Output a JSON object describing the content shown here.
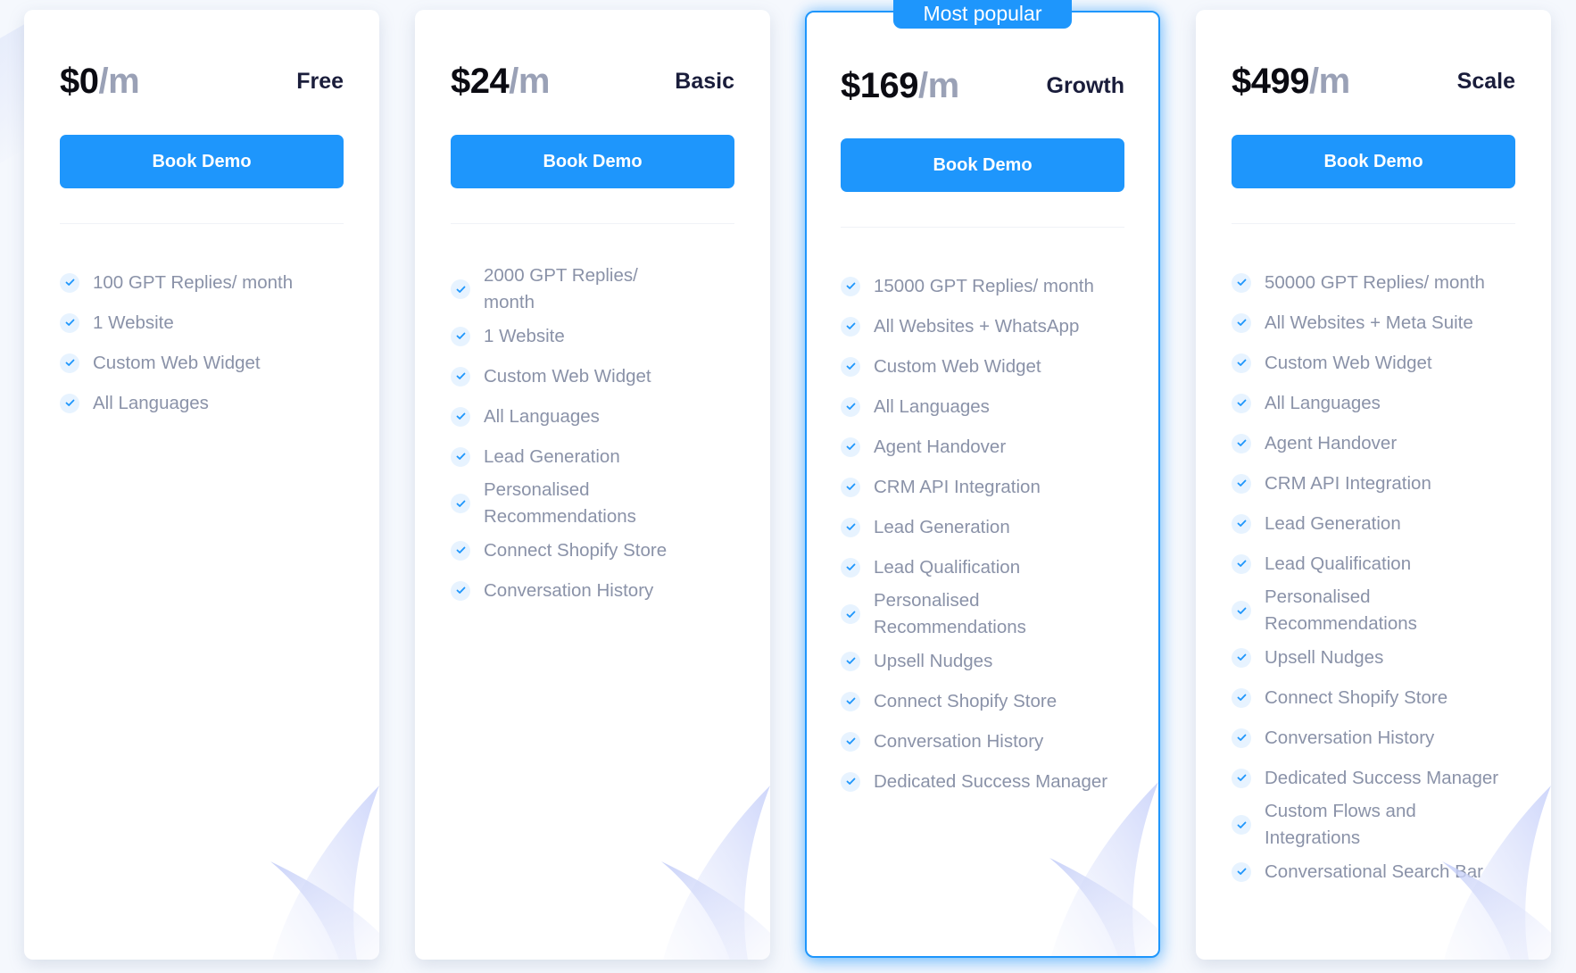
{
  "colors": {
    "accent": "#1e96fc",
    "price": "#0b0b12",
    "per": "#9aa1b6",
    "plan_name": "#1a1d3b",
    "feature_text": "#8a92a8"
  },
  "plans": [
    {
      "price": "$0",
      "period": "/m",
      "name": "Free",
      "cta": "Book Demo",
      "features": [
        "100 GPT Replies/ month",
        "1 Website",
        "Custom Web Widget",
        "All Languages"
      ]
    },
    {
      "price": "$24",
      "period": "/m",
      "name": "Basic",
      "cta": "Book Demo",
      "features": [
        "2000 GPT Replies/ month",
        "1 Website",
        "Custom Web Widget",
        "All Languages",
        "Lead Generation",
        "Personalised Recommendations",
        "Connect Shopify Store",
        "Conversation History"
      ]
    },
    {
      "badge": "Most popular",
      "price": "$169",
      "period": "/m",
      "name": "Growth",
      "cta": "Book Demo",
      "features": [
        "15000 GPT Replies/ month",
        "All Websites + WhatsApp",
        "Custom Web Widget",
        "All Languages",
        "Agent Handover",
        "CRM API Integration",
        "Lead Generation",
        "Lead Qualification",
        "Personalised Recommendations",
        "Upsell Nudges",
        "Connect Shopify Store",
        "Conversation History",
        "Dedicated Success Manager"
      ]
    },
    {
      "price": "$499",
      "period": "/m",
      "name": "Scale",
      "cta": "Book Demo",
      "features": [
        "50000 GPT Replies/ month",
        "All Websites + Meta Suite",
        "Custom Web Widget",
        "All Languages",
        "Agent Handover",
        "CRM API Integration",
        "Lead Generation",
        "Lead Qualification",
        "Personalised Recommendations",
        "Upsell Nudges",
        "Connect Shopify Store",
        "Conversation History",
        "Dedicated Success Manager",
        "Custom Flows and Integrations",
        "Conversational Search Bar"
      ]
    }
  ],
  "icons": {
    "feature_check": "check-icon"
  }
}
